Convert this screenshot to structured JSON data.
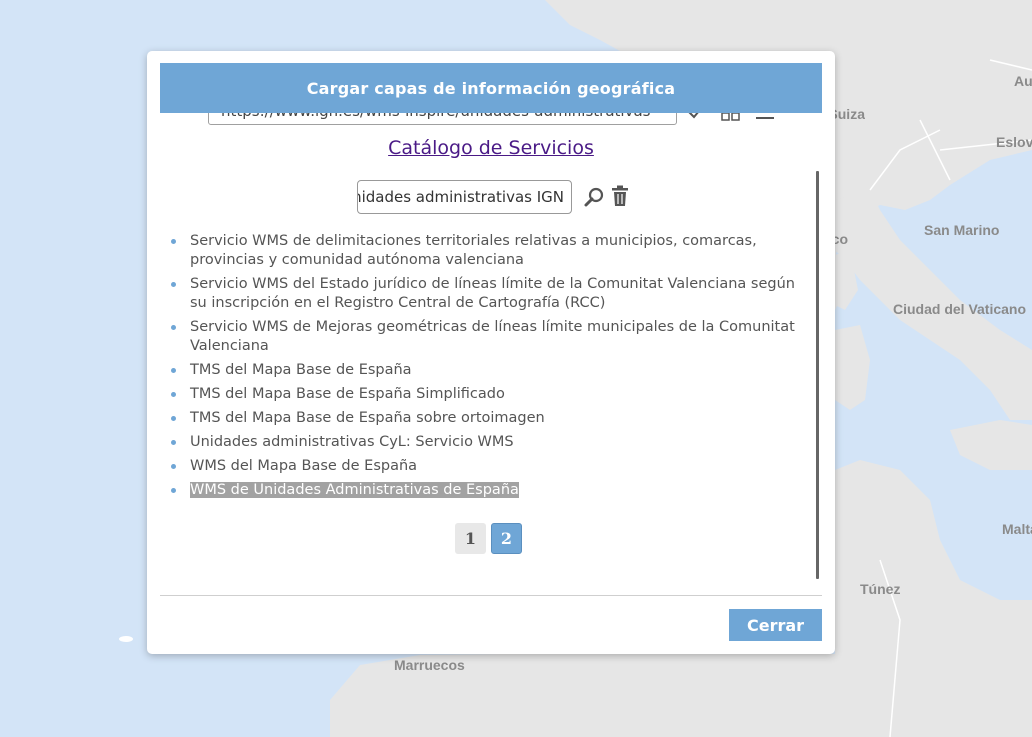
{
  "map": {
    "labels": [
      "Austria",
      "Suiza",
      "Eslovenia",
      "San Marino",
      "Ciudad del Vaticano",
      "Mónaco",
      "Túnez",
      "Malta",
      "Marruecos"
    ],
    "colors": {
      "sea": "#d3e4f7",
      "land": "#e6e6e6",
      "border": "#ffffff"
    }
  },
  "dialog": {
    "title": "Cargar capas de información geográfica",
    "url_value": "https://www.ign.es/wms-inspire/unidades-administrativas",
    "catalog_title": "Catálogo de Servicios",
    "search_value": "Unidades administrativas IGN",
    "services": [
      "Servicio WMS de delimitaciones territoriales relativas a municipios, comarcas, provincias y comunidad autónoma valenciana",
      "Servicio WMS del Estado jurídico de líneas límite de la Comunitat Valenciana según su inscripción en el Registro Central de Cartografía (RCC)",
      "Servicio WMS de Mejoras geométricas de líneas límite municipales de la Comunitat Valenciana",
      "TMS del Mapa Base de España",
      "TMS del Mapa Base de España Simplificado",
      "TMS del Mapa Base de España sobre ortoimagen",
      "Unidades administrativas CyL: Servicio WMS",
      "WMS del Mapa Base de España",
      "WMS de Unidades Administrativas de España"
    ],
    "selected_service_index": 8,
    "pages": [
      "1",
      "2"
    ],
    "active_page": "2",
    "close_label": "Cerrar"
  },
  "colors": {
    "accent": "#6fa6d6",
    "link": "#4a1a86",
    "selected_bg": "#a2a2a2"
  }
}
